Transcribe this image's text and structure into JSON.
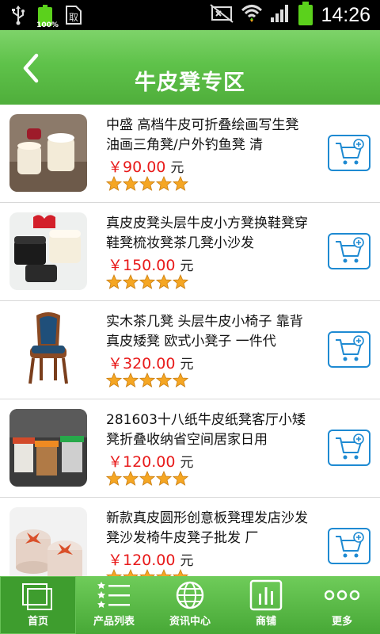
{
  "status_bar": {
    "time": "14:26",
    "battery_left_text": "100%",
    "icons": [
      "usb-icon",
      "battery-icon",
      "sim-icon",
      "mute-icon",
      "wifi-icon",
      "signal-icon",
      "battery-icon"
    ]
  },
  "header": {
    "title": "牛皮凳专区",
    "back_icon": "chevron-left-icon",
    "bg_color": "#5fc24a"
  },
  "products": [
    {
      "title": "中盛 高档牛皮可折叠绘画写生凳 油画三角凳/户外钓鱼凳 清",
      "price": "￥90.00",
      "unit": "元",
      "rating": 5
    },
    {
      "title": "真皮皮凳头层牛皮小方凳换鞋凳穿鞋凳梳妆凳茶几凳小沙发",
      "price": "￥150.00",
      "unit": "元",
      "rating": 5
    },
    {
      "title": "实木茶几凳 头层牛皮小椅子 靠背真皮矮凳 欧式小凳子 一件代",
      "price": "￥320.00",
      "unit": "元",
      "rating": 5
    },
    {
      "title": "281603十八纸牛皮纸凳客厅小矮凳折叠收纳省空间居家日用",
      "price": "￥120.00",
      "unit": "元",
      "rating": 5
    },
    {
      "title": "新款真皮圆形创意板凳理发店沙发凳沙发椅牛皮凳子批发 厂",
      "price": "￥120.00",
      "unit": "元",
      "rating": 5
    }
  ],
  "bottom_nav": [
    {
      "label": "首页",
      "icon": "home-icon",
      "active": true
    },
    {
      "label": "产品列表",
      "icon": "list-icon",
      "active": false
    },
    {
      "label": "资讯中心",
      "icon": "globe-icon",
      "active": false
    },
    {
      "label": "商铺",
      "icon": "shop-icon",
      "active": false
    },
    {
      "label": "更多",
      "icon": "more-icon",
      "active": false
    }
  ],
  "colors": {
    "price": "#e81a1a",
    "cart_border": "#1e8ad2",
    "star": "#f5a623",
    "nav_bg": "#5cbb48"
  }
}
